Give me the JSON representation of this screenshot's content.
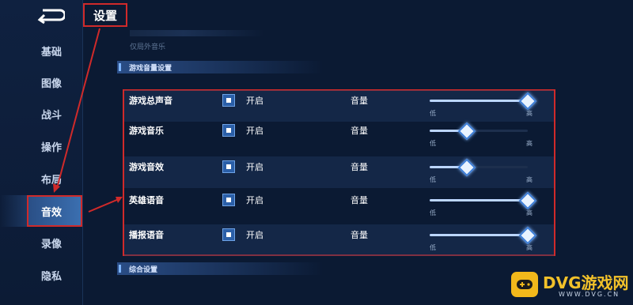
{
  "header": {
    "title": "设置"
  },
  "sidebar": {
    "items": [
      {
        "label": "基础"
      },
      {
        "label": "图像"
      },
      {
        "label": "战斗"
      },
      {
        "label": "操作"
      },
      {
        "label": "布局"
      },
      {
        "label": "音效",
        "active": true
      },
      {
        "label": "录像"
      },
      {
        "label": "隐私"
      }
    ]
  },
  "top_faded": {
    "hint": "仅局外音乐"
  },
  "sections": {
    "game_volume": "游戏音量设置",
    "general": "综合设置"
  },
  "audio_rows": [
    {
      "label": "游戏总声音",
      "toggle_label": "开启",
      "enabled": true,
      "volume_label": "音量",
      "low": "低",
      "high": "高",
      "level": 1.0
    },
    {
      "label": "游戏音乐",
      "toggle_label": "开启",
      "enabled": true,
      "volume_label": "音量",
      "low": "低",
      "high": "高",
      "level": 0.38
    },
    {
      "label": "游戏音效",
      "toggle_label": "开启",
      "enabled": true,
      "volume_label": "音量",
      "low": "低",
      "high": "高",
      "level": 0.38
    },
    {
      "label": "英雄语音",
      "toggle_label": "开启",
      "enabled": true,
      "volume_label": "音量",
      "low": "低",
      "high": "高",
      "level": 1.0
    },
    {
      "label": "播报语音",
      "toggle_label": "开启",
      "enabled": true,
      "volume_label": "音量",
      "low": "低",
      "high": "高",
      "level": 1.0
    }
  ],
  "watermark": {
    "brand": "DVG游戏网",
    "domain": "WWW.DVG.CN"
  },
  "colors": {
    "accent": "#3e7ed6",
    "highlight_border": "#d02a2a",
    "watermark": "#f2b81b"
  }
}
